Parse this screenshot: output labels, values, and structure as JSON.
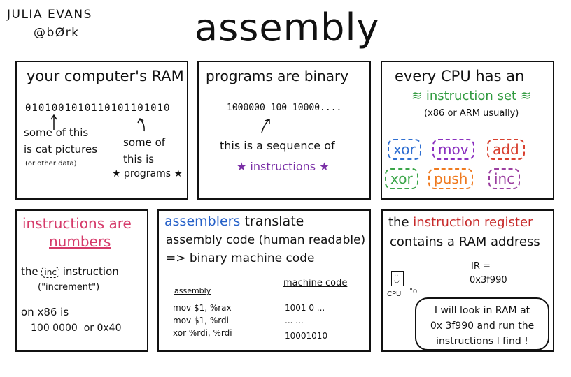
{
  "header": {
    "author_name": "JULIA EVANS",
    "author_handle": "@bØrk",
    "title": "assembly"
  },
  "panel_ram": {
    "heading": "your computer's RAM",
    "bits": "0101001010110101101010",
    "note_left_1": "some of this",
    "note_left_2": "is cat pictures",
    "note_left_3": "(or other data)",
    "note_right_1": "some of",
    "note_right_2": "this is",
    "note_right_3": "★ programs ★"
  },
  "panel_binary": {
    "heading": "programs are binary",
    "bits": "1000000 100 10000....",
    "line1": "this is a sequence of",
    "line2": "★ instructions ★"
  },
  "panel_cpu": {
    "heading": "every CPU has an",
    "subheading": "instruction set",
    "note": "(x86 or ARM usually)",
    "instructions": [
      {
        "label": "xor",
        "color": "#2f6fd1"
      },
      {
        "label": "mov",
        "color": "#8a2fbf"
      },
      {
        "label": "add",
        "color": "#d8402f"
      },
      {
        "label": "xor",
        "color": "#3aa548"
      },
      {
        "label": "push",
        "color": "#ef7a1f"
      },
      {
        "label": "inc",
        "color": "#9b3fa0"
      }
    ]
  },
  "panel_numbers": {
    "heading_1": "instructions are",
    "heading_2": "numbers",
    "line1_a": "the",
    "line1_chip": "inc",
    "line1_b": "instruction",
    "line2": "(\"increment\")",
    "line3": "on x86 is",
    "line4": "100 0000  or 0x40"
  },
  "panel_assemblers": {
    "heading_a": "assemblers",
    "heading_b": "translate",
    "line1": "assembly code (human readable)",
    "line2": "=> binary machine code",
    "col_assembly": "assembly",
    "col_machine": "machine code",
    "rows": [
      {
        "asm": "mov $1, %rax",
        "code": "1001 0 ..."
      },
      {
        "asm": "mov $1, %rdi",
        "code": "... ..."
      },
      {
        "asm": "xor %rdi, %rdi",
        "code": "10001010"
      }
    ]
  },
  "panel_register": {
    "heading_a": "the",
    "heading_b": "instruction register",
    "line2": "contains a RAM address",
    "ir_label": "IR =",
    "ir_value": "0x3f990",
    "cpu_label": "CPU",
    "speech_1": "I will look in RAM at",
    "speech_2": "0x 3f990 and run the",
    "speech_3": "instructions I find !"
  },
  "colors": {
    "green": "#2f9a3e",
    "purple": "#7a2fa6",
    "pink": "#d63a6a",
    "blue": "#2560c8",
    "red": "#c72a2a"
  }
}
